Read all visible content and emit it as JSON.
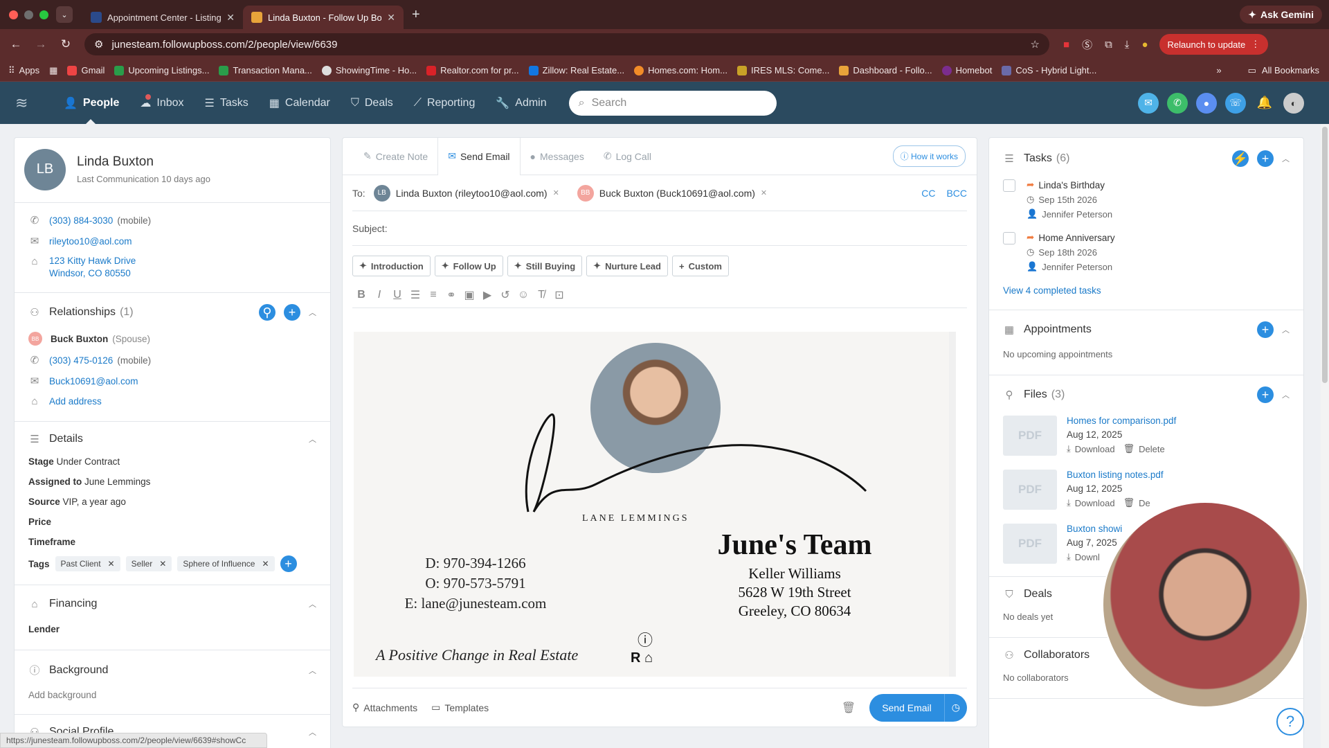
{
  "browser": {
    "tabs": [
      {
        "title": "Appointment Center - Listing"
      },
      {
        "title": "Linda Buxton - Follow Up Bos"
      }
    ],
    "url": "junesteam.followupboss.com/2/people/view/6639",
    "ask_gemini": "Ask Gemini",
    "relaunch": "Relaunch to update",
    "bookmarks": [
      "Apps",
      "Gmail",
      "Upcoming Listings...",
      "Transaction Mana...",
      "ShowingTime - Ho...",
      "Realtor.com for pr...",
      "Zillow: Real Estate...",
      "Homes.com: Hom...",
      "IRES MLS: Come...",
      "Dashboard - Follo...",
      "Homebot",
      "CoS - Hybrid Light..."
    ],
    "all_bookmarks": "All Bookmarks",
    "status_url": "https://junesteam.followupboss.com/2/people/view/6639#showCc"
  },
  "nav": {
    "items": [
      "People",
      "Inbox",
      "Tasks",
      "Calendar",
      "Deals",
      "Reporting",
      "Admin"
    ],
    "search_placeholder": "Search"
  },
  "contact": {
    "initials": "LB",
    "name": "Linda Buxton",
    "last_comm": "Last Communication 10 days ago",
    "phone": "(303) 884-3030",
    "phone_type": "(mobile)",
    "email": "rileytoo10@aol.com",
    "address1": "123 Kitty Hawk Drive",
    "address2": "Windsor, CO 80550"
  },
  "relationships": {
    "title": "Relationships",
    "count": "(1)",
    "initials": "BB",
    "name": "Buck Buxton",
    "role": "(Spouse)",
    "phone": "(303) 475-0126",
    "phone_type": "(mobile)",
    "email": "Buck10691@aol.com",
    "add_address": "Add address"
  },
  "details": {
    "title": "Details",
    "stage_label": "Stage",
    "stage": "Under Contract",
    "assigned_label": "Assigned to",
    "assigned": "June Lemmings",
    "source_label": "Source",
    "source": "VIP, a year ago",
    "price_label": "Price",
    "timeframe_label": "Timeframe",
    "tags_label": "Tags",
    "tags": [
      "Past Client",
      "Seller",
      "Sphere of Influence"
    ]
  },
  "financing": {
    "title": "Financing",
    "lender_label": "Lender"
  },
  "background": {
    "title": "Background",
    "add": "Add background"
  },
  "social": {
    "title": "Social Profile"
  },
  "composer": {
    "tabs": [
      "Create Note",
      "Send Email",
      "Messages",
      "Log Call"
    ],
    "how_it_works": "How it works",
    "to_label": "To:",
    "recipients": [
      {
        "initials": "LB",
        "name": "Linda Buxton (rileytoo10@aol.com)"
      },
      {
        "initials": "BB",
        "name": "Buck Buxton (Buck10691@aol.com)"
      }
    ],
    "cc": "CC",
    "bcc": "BCC",
    "subject_label": "Subject:",
    "templates": [
      "Introduction",
      "Follow Up",
      "Still Buying",
      "Nurture Lead",
      "Custom"
    ],
    "attachments": "Attachments",
    "templates_label": "Templates",
    "send": "Send Email"
  },
  "signature": {
    "name": "LANE LEMMINGS",
    "team": "June's Team",
    "direct": "D: 970-394-1266",
    "office": "O: 970-573-5791",
    "email": "E: lane@junesteam.com",
    "brokerage": "Keller Williams",
    "street": "5628 W 19th Street",
    "city": "Greeley, CO 80634",
    "tagline": "A Positive Change in Real Estate"
  },
  "tasks": {
    "title": "Tasks",
    "count": "(6)",
    "items": [
      {
        "title": "Linda's Birthday",
        "date": "Sep 15th 2026",
        "assignee": "Jennifer Peterson"
      },
      {
        "title": "Home Anniversary",
        "date": "Sep 18th 2026",
        "assignee": "Jennifer Peterson"
      }
    ],
    "completed_link": "View 4 completed tasks"
  },
  "appointments": {
    "title": "Appointments",
    "empty": "No upcoming appointments"
  },
  "files": {
    "title": "Files",
    "count": "(3)",
    "items": [
      {
        "name": "Homes for comparison.pdf",
        "date": "Aug 12, 2025",
        "download": "Download",
        "delete": "Delete",
        "thumb": "PDF"
      },
      {
        "name": "Buxton listing notes.pdf",
        "date": "Aug 12, 2025",
        "download": "Download",
        "delete": "De",
        "thumb": "PDF"
      },
      {
        "name": "Buxton showi",
        "date": "Aug 7, 2025",
        "download": "Downl",
        "thumb": "PDF"
      }
    ]
  },
  "deals": {
    "title": "Deals",
    "empty": "No deals yet"
  },
  "collaborators": {
    "title": "Collaborators",
    "empty": "No collaborators"
  },
  "colors": {
    "nav": "#2b4a5f",
    "accent": "#2c8ee0",
    "chrome": "#5b2c2c"
  }
}
